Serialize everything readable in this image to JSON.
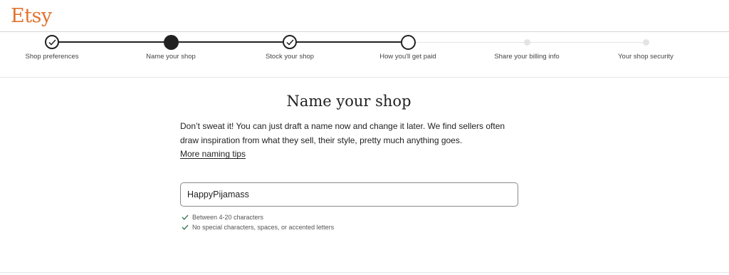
{
  "brand": {
    "logo_text": "Etsy",
    "accent_color": "#e1732f"
  },
  "stepper": {
    "steps": [
      {
        "label": "Shop preferences",
        "state": "completed",
        "icon": "check-icon"
      },
      {
        "label": "Name your shop",
        "state": "current"
      },
      {
        "label": "Stock your shop",
        "state": "completed",
        "icon": "check-icon"
      },
      {
        "label": "How you'll get paid",
        "state": "next"
      },
      {
        "label": "Share your billing info",
        "state": "upcoming"
      },
      {
        "label": "Your shop security",
        "state": "upcoming"
      }
    ]
  },
  "main": {
    "title": "Name your shop",
    "description": "Don’t sweat it! You can just draft a name now and change it later. We find sellers often draw inspiration from what they sell, their style, pretty much anything goes.",
    "tips_link": "More naming tips",
    "shop_name_value": "HappyPijamass",
    "rules": [
      {
        "text": "Between 4-20 characters",
        "icon": "check-icon",
        "status": "passed",
        "color": "#3f7a57"
      },
      {
        "text": "No special characters, spaces, or accented letters",
        "icon": "check-icon",
        "status": "passed",
        "color": "#3f7a57"
      }
    ]
  }
}
